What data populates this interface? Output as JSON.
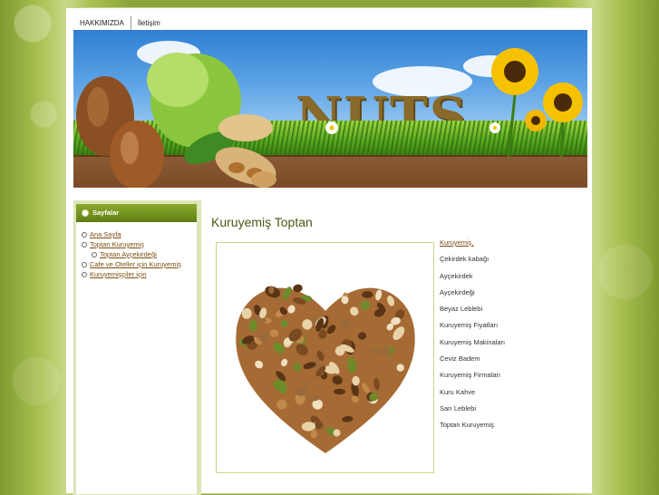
{
  "nav": {
    "items": [
      {
        "label": "HAKKIMIZDA"
      },
      {
        "label": "İletişim"
      }
    ]
  },
  "banner": {
    "word": "NUTS"
  },
  "sidebar": {
    "title": "Sayfalar",
    "items": [
      {
        "label": "Ana Sayfa"
      },
      {
        "label": "Toptan Kuruyemiş"
      },
      {
        "label": "Toptan Ayçekirdeği"
      },
      {
        "label": "Cafe ve Oteller için Kuruyemiş"
      },
      {
        "label": "Kuruyemişçiler için"
      }
    ]
  },
  "main": {
    "title": "Kuruyemiş Toptan",
    "links": [
      {
        "label": "Kuruyemiş,"
      },
      {
        "label": "Çekirdek kabağı"
      },
      {
        "label": "Ayçekirdek"
      },
      {
        "label": "Ayçekirdeği"
      },
      {
        "label": "Beyaz Leblebi"
      },
      {
        "label": "Kuruyemiş Fiyatları"
      },
      {
        "label": "Kuruyemiş Makinaları"
      },
      {
        "label": "Ceviz Badem"
      },
      {
        "label": "Kuruyemiş Firmaları"
      },
      {
        "label": "Kuru Kahve"
      },
      {
        "label": "Sarı Leblebi"
      },
      {
        "label": "Toptan Kuruyemiş"
      }
    ]
  },
  "colors": {
    "accent": "#5e7d14",
    "link": "#7b4f10",
    "title": "#4a5a12"
  }
}
